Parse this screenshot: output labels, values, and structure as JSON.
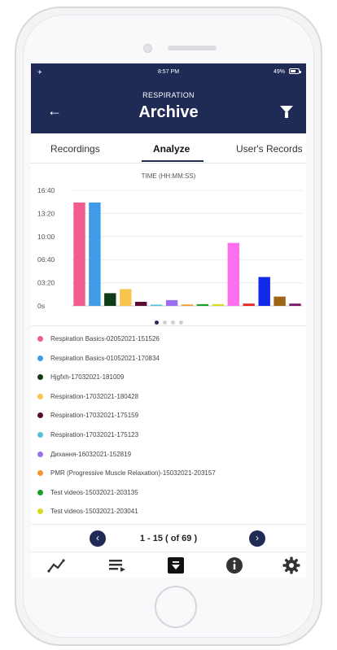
{
  "status_bar": {
    "time": "8:57 PM",
    "battery": "49%"
  },
  "header": {
    "subtitle": "RESPIRATION",
    "title": "Archive"
  },
  "tabs": [
    {
      "label": "Recordings"
    },
    {
      "label": "Analyze"
    },
    {
      "label": "User's Records"
    }
  ],
  "chart_data": {
    "type": "bar",
    "title": "TIME (HH:MM:SS)",
    "y_ticks": [
      "0s",
      "03:20",
      "06:40",
      "10:00",
      "13:20",
      "16:40"
    ],
    "ylim_seconds": [
      0,
      1000
    ],
    "categories": [
      "Respiration Basics-02052021-151526",
      "Respiration Basics-01052021-170834",
      "Hjgfxh-17032021-181009",
      "Respiration-17032021-180428",
      "Respiration-17032021-175159",
      "Respiration-17032021-175123",
      "Дихання-16032021-152819",
      "PMR (Progressive Muscle Relaxation)-15032021-203157",
      "Test videos-15032021-203135",
      "Test videos-15032021-203041",
      "",
      "",
      "",
      "",
      ""
    ],
    "values_seconds": [
      895,
      895,
      110,
      145,
      35,
      0,
      50,
      12,
      15,
      15,
      545,
      20,
      250,
      80,
      20
    ],
    "colors": [
      "#f25c8e",
      "#3f9be8",
      "#0f3b17",
      "#f7c44c",
      "#5a0c32",
      "#4fc3d3",
      "#9b6ef2",
      "#f5962a",
      "#1e9e2a",
      "#d7dc22",
      "#ff70f0",
      "#e8242c",
      "#1229e8",
      "#9c6414",
      "#7a1a6a"
    ]
  },
  "pagination_dots": {
    "count": 4,
    "active": 0
  },
  "legend": [
    {
      "label": "Respiration Basics-02052021-151526",
      "color": "#f25c8e"
    },
    {
      "label": "Respiration Basics-01052021-170834",
      "color": "#3f9be8"
    },
    {
      "label": "Hjgfxh-17032021-181009",
      "color": "#0f3b17"
    },
    {
      "label": "Respiration-17032021-180428",
      "color": "#f7c44c"
    },
    {
      "label": "Respiration-17032021-175159",
      "color": "#5a0c32"
    },
    {
      "label": "Respiration-17032021-175123",
      "color": "#4fc3d3"
    },
    {
      "label": "Дихання-16032021-152819",
      "color": "#9b6ef2"
    },
    {
      "label": "PMR (Progressive Muscle Relaxation)-15032021-203157",
      "color": "#f5962a"
    },
    {
      "label": "Test videos-15032021-203135",
      "color": "#1e9e2a"
    },
    {
      "label": "Test videos-15032021-203041",
      "color": "#d7dc22"
    }
  ],
  "pager": {
    "text": "1 - 15 ( of 69 )",
    "prev": "‹",
    "next": "›"
  },
  "nav": {
    "items": [
      {
        "icon": "trend-icon"
      },
      {
        "icon": "playlist-icon"
      },
      {
        "icon": "archive-icon"
      },
      {
        "icon": "info-icon"
      },
      {
        "icon": "gear-icon"
      }
    ]
  }
}
